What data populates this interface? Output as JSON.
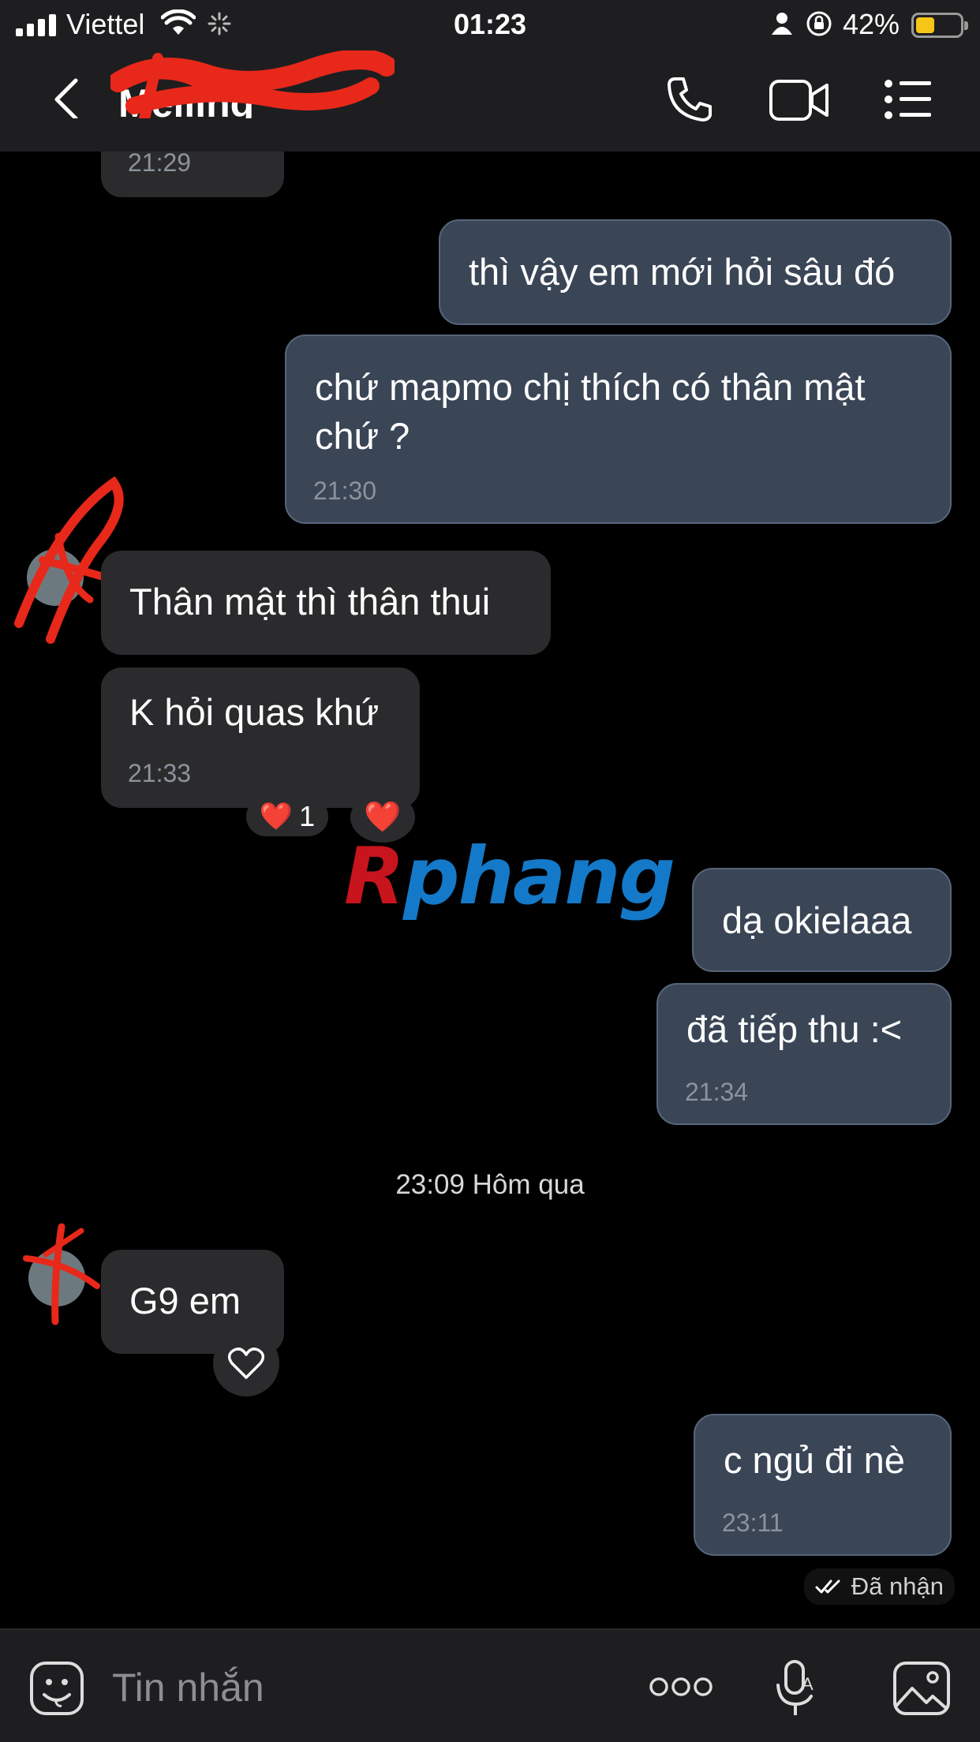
{
  "status_bar": {
    "carrier": "Viettel",
    "time": "01:23",
    "battery_percent": "42%",
    "battery_level": 0.42,
    "battery_color": "#f5c518"
  },
  "header": {
    "contact_name": "Meiling",
    "icons": [
      "back-icon",
      "phone-icon",
      "video-icon",
      "menu-icon"
    ]
  },
  "messages": [
    {
      "from": "them",
      "text": "",
      "time": "21:29"
    },
    {
      "from": "me",
      "text": "thì vậy em mới hỏi sâu đó",
      "time": ""
    },
    {
      "from": "me",
      "text": "chứ mapmo chị thích có thân mật chứ ?",
      "time": "21:30"
    },
    {
      "from": "them",
      "text": "Thân mật thì thân thui",
      "time": ""
    },
    {
      "from": "them",
      "text": "K hỏi quas khứ",
      "time": "21:33",
      "reaction": "❤️",
      "reaction_count": "1",
      "quick_reaction": "❤️"
    },
    {
      "from": "me",
      "text": "dạ okielaaa",
      "time": ""
    },
    {
      "from": "me",
      "text": "đã tiếp thu :<",
      "time": "21:34"
    },
    {
      "from": "them",
      "text": "G9 em",
      "time": "",
      "quick_reaction": "heart-outline-icon"
    },
    {
      "from": "me",
      "text": "c ngủ đi nè",
      "time": "23:11"
    }
  ],
  "day_separator": "23:09 Hôm qua",
  "delivery_status": "Đã nhận",
  "watermark": {
    "first": "R",
    "rest": "phang"
  },
  "input": {
    "placeholder": "Tin nhắn",
    "icons": [
      "sticker-icon",
      "more-icon",
      "voice-icon",
      "image-icon"
    ]
  },
  "colors": {
    "background": "#000000",
    "bar": "#1e1e20",
    "incoming_bubble": "#2b2b2d",
    "outgoing_bubble": "#3a4556",
    "timestamp": "#8c939c"
  }
}
